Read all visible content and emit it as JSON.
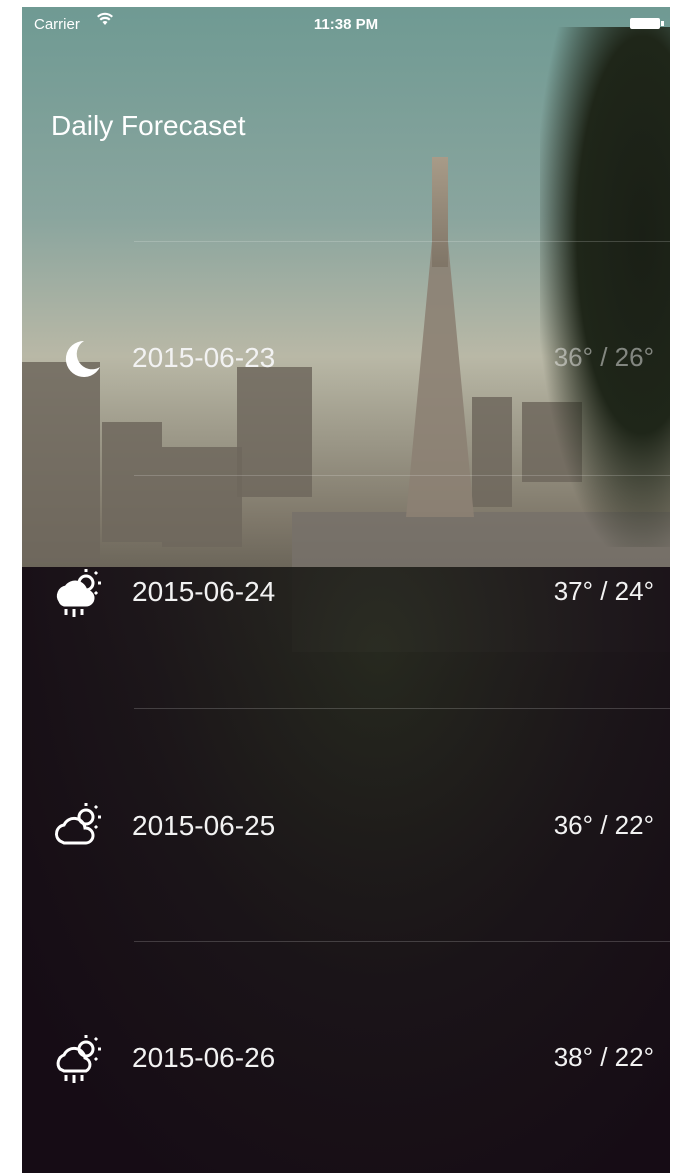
{
  "status_bar": {
    "carrier": "Carrier",
    "time": "11:38 PM"
  },
  "title": "Daily Forecaset",
  "forecast": [
    {
      "date": "2015-06-23",
      "temp": "36° / 26°",
      "icon": "moon-icon"
    },
    {
      "date": "2015-06-24",
      "temp": "37° / 24°",
      "icon": "sun-cloud-rain-icon"
    },
    {
      "date": "2015-06-25",
      "temp": "36° / 22°",
      "icon": "sun-cloud-icon"
    },
    {
      "date": "2015-06-26",
      "temp": "38° / 22°",
      "icon": "sun-cloud-rain-icon"
    }
  ],
  "colors": {
    "text": "#ffffff",
    "sky": "#6f9a93",
    "dark": "#170d16"
  }
}
